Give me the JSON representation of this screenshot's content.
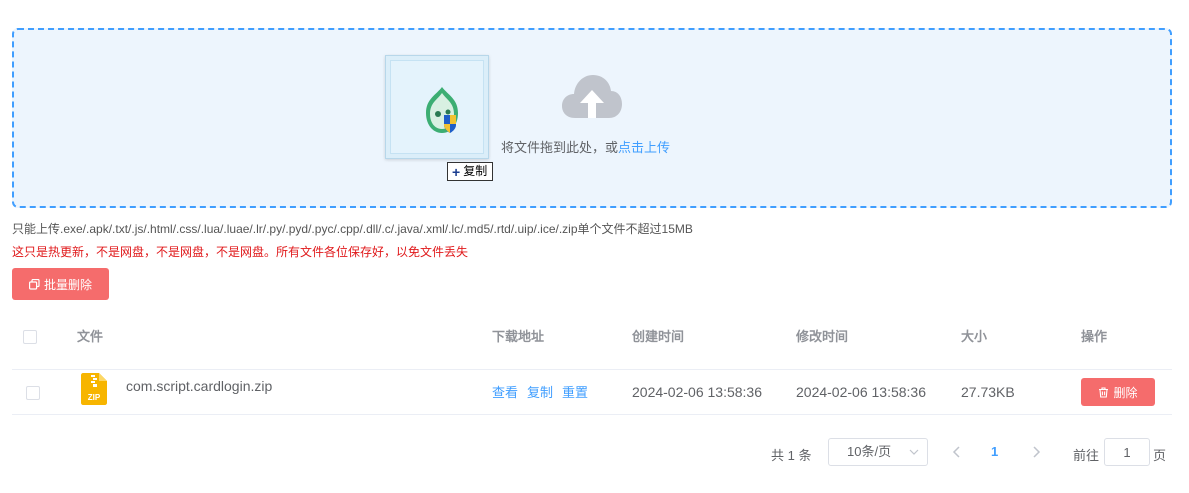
{
  "upload": {
    "drop_text": "将文件拖到此处，或",
    "click_link": "点击上传",
    "drag_tooltip": "复制"
  },
  "tips": {
    "allowed_types": "只能上传.exe/.apk/.txt/.js/.html/.css/.lua/.luae/.lr/.py/.pyd/.pyc/.cpp/.dll/.c/.java/.xml/.lc/.md5/.rtd/.uip/.ice/.zip单个文件不超过15MB",
    "warning": "这只是热更新，不是网盘，不是网盘，不是网盘。所有文件各位保存好，以免文件丢失"
  },
  "toolbar": {
    "batch_delete_label": "批量删除"
  },
  "table": {
    "headers": {
      "file": "文件",
      "download": "下载地址",
      "created": "创建时间",
      "modified": "修改时间",
      "size": "大小",
      "actions": "操作"
    },
    "rows": [
      {
        "file_name": "com.script.cardlogin.zip",
        "file_type_badge": "ZIP",
        "view_label": "查看",
        "copy_label": "复制",
        "reset_label": "重置",
        "created": "2024-02-06 13:58:36",
        "modified": "2024-02-06 13:58:36",
        "size": "27.73KB",
        "delete_label": "删除"
      }
    ]
  },
  "pagination": {
    "total_text": "共 1 条",
    "page_size": "10条/页",
    "current_page": "1",
    "goto_label": "前往",
    "goto_value": "1",
    "page_suffix": "页"
  },
  "colors": {
    "primary": "#409eff",
    "danger": "#f56c6c",
    "warning_text": "#e0191b",
    "upload_bg": "#edf5fd",
    "zip_icon": "#f7b500"
  },
  "icons": {
    "cloud": "upload-cloud-icon",
    "batch": "copy-delete-icon",
    "trash": "trash-icon",
    "zip": "zip-file-icon",
    "app": "app-shield-icon"
  }
}
